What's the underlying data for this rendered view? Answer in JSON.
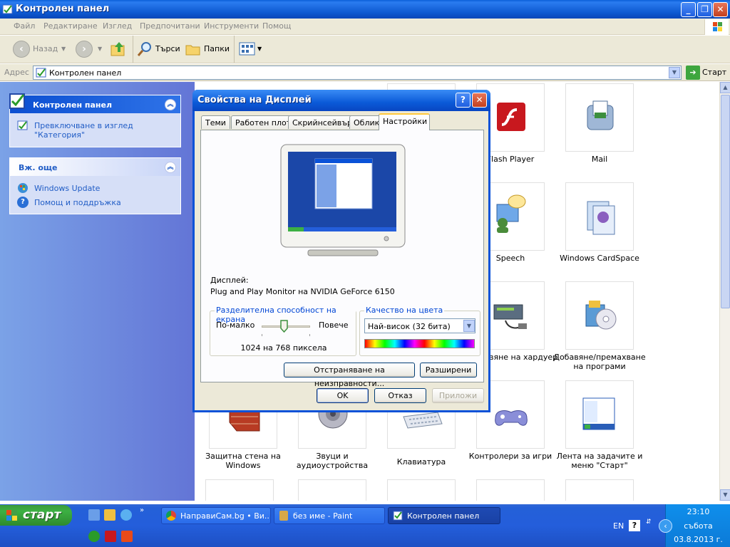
{
  "window": {
    "title": "Контролен панел"
  },
  "menu": [
    "Файл",
    "Редактиране",
    "Изглед",
    "Предпочитани",
    "Инструменти",
    "Помощ"
  ],
  "toolbar": {
    "back": "Назад",
    "search": "Търси",
    "folders": "Папки"
  },
  "address": {
    "label": "Адрес",
    "value": "Контролен панел",
    "go": "Старт"
  },
  "sidebar": {
    "panel_title": "Контролен панел",
    "switch_view": "Превключване в изглед \"Категория\"",
    "see_also_title": "Вж. още",
    "links": [
      "Windows Update",
      "Помощ и поддръжка"
    ]
  },
  "items": [
    {
      "label": "Flash Player",
      "icon": "flash-icon"
    },
    {
      "label": "Mail",
      "icon": "mail-icon"
    },
    {
      "label": "Speech",
      "icon": "speech-icon"
    },
    {
      "label": "Windows CardSpace",
      "icon": "cardspace-icon"
    },
    {
      "label": "вяне на хардуер",
      "icon": "add-hardware-icon"
    },
    {
      "label": "Добавяне/премахване на програми",
      "icon": "add-remove-programs-icon"
    },
    {
      "label": "Защитна стена на Windows",
      "icon": "firewall-icon"
    },
    {
      "label": "Звуци и аудиоустройства",
      "icon": "sounds-icon"
    },
    {
      "label": "Клавиатура",
      "icon": "keyboard-icon"
    },
    {
      "label": "Контролери за игри",
      "icon": "game-controllers-icon"
    },
    {
      "label": "Лента на задачите и меню \"Старт\"",
      "icon": "taskbar-icon"
    }
  ],
  "dialog": {
    "title": "Свойства на Дисплей",
    "tabs": [
      "Теми",
      "Работен плот",
      "Скрийнсейвър",
      "Облик",
      "Настройки"
    ],
    "selected_tab": "Настройки",
    "display_label": "Дисплей:",
    "display_value": "Plug and Play Monitor на NVIDIA GeForce 6150",
    "resolution_group": "Разделителна способност на екрана",
    "less": "По-малко",
    "more": "Повече",
    "resolution_value": "1024 на 768 пиксела",
    "resolution_level": 0.45,
    "color_group": "Качество на цвета",
    "color_value": "Най-висок (32 бита)",
    "troubleshoot": "Отстраняване на неизправности...",
    "advanced": "Разширени",
    "ok": "OK",
    "cancel": "Отказ",
    "apply": "Приложи"
  },
  "taskbar": {
    "start": "старт",
    "tasks": [
      "НаправиСам.bg • Ви...",
      "без име - Paint",
      "Контролен панел"
    ],
    "active_task": "Контролен панел",
    "lang": "EN",
    "time": "23:10",
    "day": "събота",
    "date": "03.8.2013 г."
  },
  "colors": {
    "xp_blue": "#0a52d8",
    "link": "#215dc6",
    "start_green": "#3cb043",
    "tray": "#0c7ad7"
  }
}
